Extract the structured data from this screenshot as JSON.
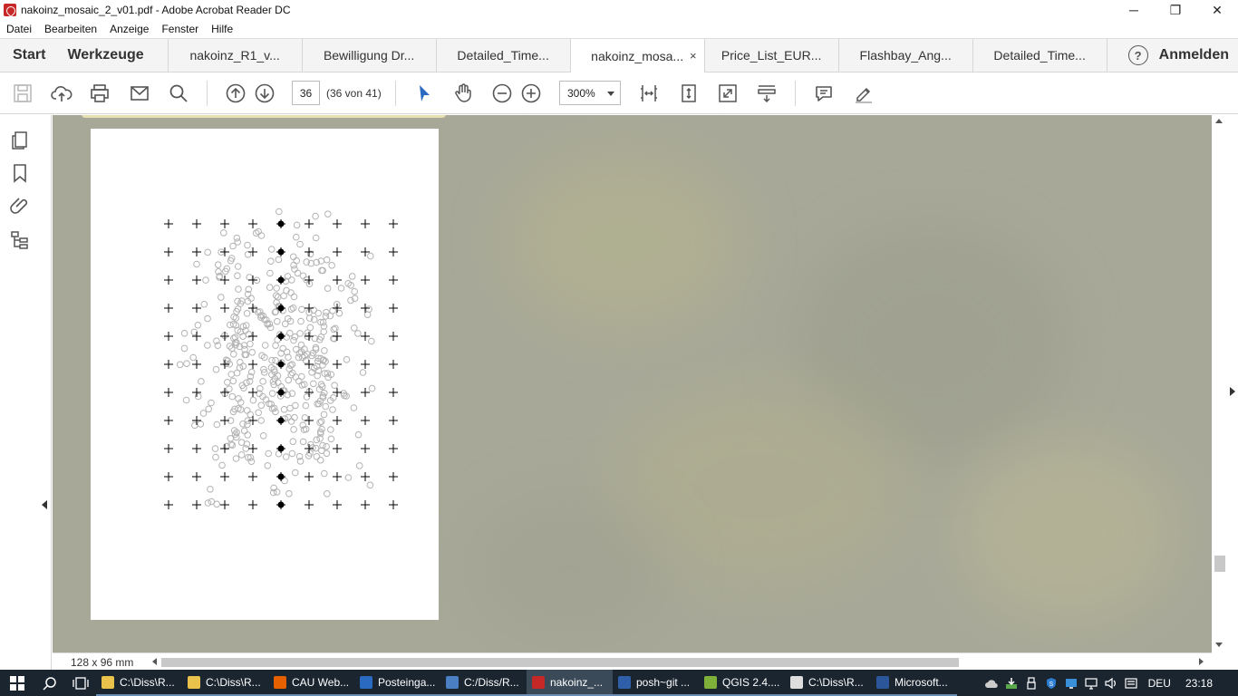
{
  "window": {
    "title": "nakoinz_mosaic_2_v01.pdf - Adobe Acrobat Reader DC",
    "minimize": "─",
    "maximize": "❐",
    "close": "✕"
  },
  "menu": [
    "Datei",
    "Bearbeiten",
    "Anzeige",
    "Fenster",
    "Hilfe"
  ],
  "tabs": {
    "home": "Start",
    "tools": "Werkzeuge",
    "documents": [
      {
        "label": "nakoinz_R1_v...",
        "active": false
      },
      {
        "label": "Bewilligung Dr...",
        "active": false
      },
      {
        "label": "Detailed_Time...",
        "active": false
      },
      {
        "label": "nakoinz_mosa...",
        "active": true,
        "close": "×"
      },
      {
        "label": "Price_List_EUR...",
        "active": false
      },
      {
        "label": "Flashbay_Ang...",
        "active": false
      },
      {
        "label": "Detailed_Time...",
        "active": false
      }
    ],
    "help": "?",
    "signin": "Anmelden"
  },
  "toolbar": {
    "page_number": "36",
    "page_count": "(36 von 41)",
    "zoom": "300%"
  },
  "status": {
    "page_size": "128 x 96 mm"
  },
  "taskbar": {
    "items": [
      {
        "label": "C:\\Diss\\R...",
        "icon_color": "#e8c24a",
        "active": false
      },
      {
        "label": "C:\\Diss\\R...",
        "icon_color": "#e8c24a",
        "active": false
      },
      {
        "label": "CAU Web...",
        "icon_color": "#e66000",
        "active": false
      },
      {
        "label": "Posteinga...",
        "icon_color": "#2a6ac0",
        "active": false
      },
      {
        "label": "C:/Diss/R...",
        "icon_color": "#4a7fc1",
        "active": false
      },
      {
        "label": "nakoinz_...",
        "icon_color": "#c62828",
        "active": true
      },
      {
        "label": "posh~git ...",
        "icon_color": "#2f5fa8",
        "active": false
      },
      {
        "label": "QGIS 2.4....",
        "icon_color": "#7fb13a",
        "active": false
      },
      {
        "label": "C:\\Diss\\R...",
        "icon_color": "#dddddd",
        "active": false
      },
      {
        "label": "Microsoft...",
        "icon_color": "#2b579a",
        "active": false
      }
    ],
    "language": "DEU",
    "time": "23:18"
  }
}
